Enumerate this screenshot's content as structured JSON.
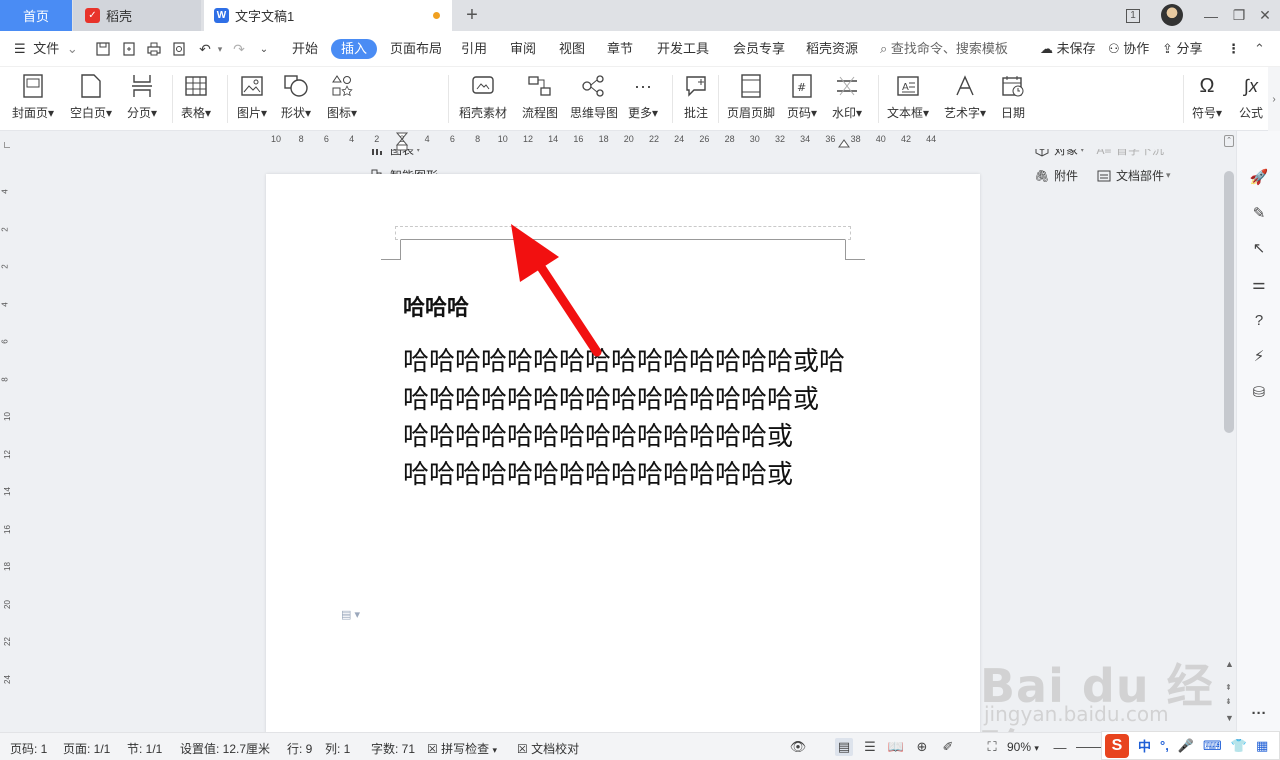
{
  "tabs": {
    "home": "首页",
    "daoke": "稻壳",
    "doc": "文字文稿1",
    "add": "+"
  },
  "window": {
    "page_count_badge": "1"
  },
  "menubar": {
    "file": "文件",
    "items": [
      "开始",
      "插入",
      "页面布局",
      "引用",
      "审阅",
      "视图",
      "章节",
      "开发工具",
      "会员专享",
      "稻壳资源"
    ],
    "active": "插入",
    "search_placeholder": "查找命令、搜索模板",
    "unsaved": "未保存",
    "collab": "协作",
    "share": "分享"
  },
  "ribbon": {
    "cover": "封面页",
    "blank": "空白页",
    "pagebreak": "分页",
    "table": "表格",
    "picture": "图片",
    "shape": "形状",
    "icon": "图标",
    "chart": "图表",
    "smartart": "智能图形",
    "material": "稻壳素材",
    "flowchart": "流程图",
    "mindmap": "思维导图",
    "more": "更多",
    "comment": "批注",
    "headerfooter": "页眉页脚",
    "pagenum": "页码",
    "watermark": "水印",
    "textbox": "文本框",
    "wordart": "艺术字",
    "date": "日期",
    "object": "对象",
    "dropcap": "首字下沉",
    "attachment": "附件",
    "docpart": "文档部件",
    "symbol": "符号",
    "formula": "公式"
  },
  "ruler": {
    "h_ticks": [
      "10",
      "8",
      "6",
      "4",
      "2",
      "2",
      "4",
      "6",
      "8",
      "10",
      "12",
      "14",
      "16",
      "18",
      "20",
      "22",
      "24",
      "26",
      "28",
      "30",
      "32",
      "34",
      "36",
      "38",
      "40",
      "42",
      "44"
    ],
    "v_ticks": [
      "4",
      "2",
      "2",
      "4",
      "6",
      "8",
      "10",
      "12",
      "14",
      "16",
      "18",
      "20",
      "22",
      "24"
    ]
  },
  "document": {
    "title": "哈哈哈",
    "paragraphs": [
      "哈哈哈哈哈哈哈哈哈哈哈哈哈哈哈或哈哈哈哈哈哈哈哈哈哈哈哈哈哈哈哈或",
      "哈哈哈哈哈哈哈哈哈哈哈哈哈哈或",
      "哈哈哈哈哈哈哈哈哈哈哈哈哈哈或"
    ]
  },
  "statusbar": {
    "page_num": "页码: 1",
    "pages": "页面: 1/1",
    "section": "节: 1/1",
    "setting": "设置值: 12.7厘米",
    "row": "行: 9",
    "col": "列: 1",
    "words": "字数: 71",
    "spellcheck": "拼写检查",
    "proof": "文档校对",
    "zoom": "90%"
  },
  "ime": {
    "mode": "中"
  },
  "watermark": {
    "brand": "Bai du 经验",
    "url": "jingyan.baidu.com"
  },
  "colors": {
    "accent": "#4a8cf4",
    "arrow": "#f21010",
    "ime": "#e8441e"
  }
}
